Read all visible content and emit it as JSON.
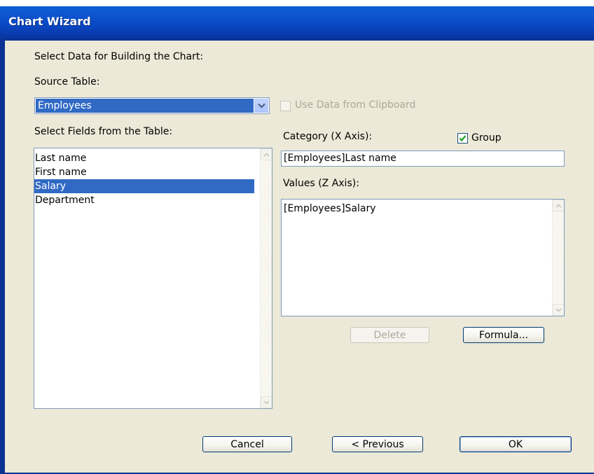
{
  "window": {
    "title": "Chart Wizard"
  },
  "intro_label": "Select Data for Building the Chart:",
  "source_table": {
    "label": "Source Table:",
    "value": "Employees"
  },
  "clipboard_option": {
    "label": "Use Data from Clipboard",
    "checked": false,
    "enabled": false
  },
  "fields": {
    "label": "Select Fields from the Table:",
    "items": [
      "Last name",
      "First name",
      "Salary",
      "Department"
    ],
    "selected": "Salary"
  },
  "category": {
    "label": "Category (X Axis):",
    "value": "[Employees]Last name"
  },
  "group": {
    "label": "Group",
    "checked": true
  },
  "values": {
    "label": "Values (Z Axis):",
    "items": [
      "[Employees]Salary"
    ]
  },
  "buttons": {
    "delete": "Delete",
    "formula": "Formula...",
    "cancel": "Cancel",
    "previous": "< Previous",
    "ok": "OK"
  },
  "colors": {
    "selection": "#316ac5",
    "title_bar": "#0a48c4",
    "dialog_face": "#ece9d8"
  },
  "icons": {
    "combo_arrow": "chevron-down-icon",
    "checkmark": "check-icon"
  }
}
